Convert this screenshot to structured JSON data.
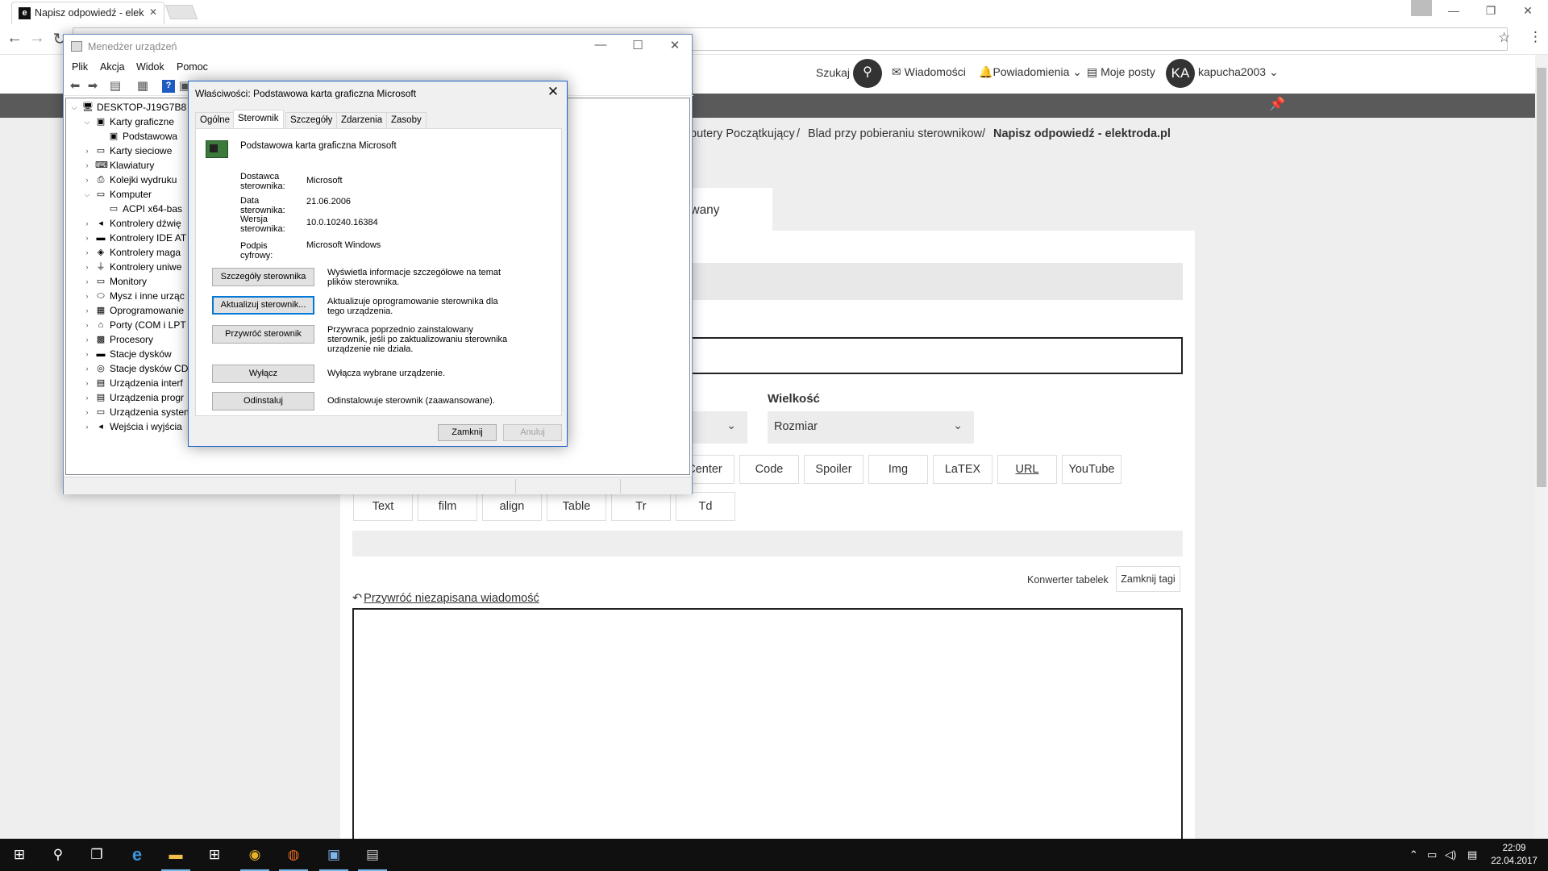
{
  "browser": {
    "tab_title": "Napisz odpowiedź - elek",
    "tab_favicon": "e",
    "close_glyph": "✕",
    "window_minimize": "—",
    "window_restore": "❐",
    "window_close": "✕",
    "back_glyph": "←",
    "forward_glyph": "→",
    "reload_glyph": "↻",
    "star_glyph": "☆",
    "menu_glyph": "⋮"
  },
  "site_header": {
    "search_label": "Szukaj",
    "search_glyph": "⚲",
    "messages": "Wiadomości",
    "notifications": "Powiadomienia",
    "my_posts": "Moje posty",
    "avatar_initials": "KA",
    "username": "kapucha2003",
    "pin_glyph": "📌"
  },
  "breadcrumb": {
    "item1": "putery Początkujący",
    "sep": "/",
    "item2": "Blad przy pobieraniu sterownikow",
    "item3": "Napisz odpowiedź - elektroda.pl"
  },
  "editor": {
    "tab_active_label": "sowany",
    "size_label": "Wielkość",
    "size_select": "Rozmiar",
    "chevron": "⌄",
    "bb_row1": [
      "Center",
      "Code",
      "Spoiler",
      "Img",
      "LaTEX",
      "URL",
      "YouTube"
    ],
    "bb_row2": [
      "Text",
      "film",
      "align",
      "Table",
      "Tr",
      "Td"
    ],
    "converter_label": "Konwerter tabelek",
    "close_tags": "Zamknij tagi",
    "restore_link": "Przywróć niezapisana wiadomość",
    "restore_glyph": "↶"
  },
  "device_manager": {
    "title": "Menedżer urządzeń",
    "menu": [
      "Plik",
      "Akcja",
      "Widok",
      "Pomoc"
    ],
    "tree": [
      {
        "label": "DESKTOP-J19G7B8",
        "level": 0,
        "toggle": "⌵",
        "icon": "computer-icon",
        "glyph": "🖥"
      },
      {
        "label": "Karty graficzne",
        "level": 1,
        "toggle": "⌵",
        "icon": "display-adapter-icon",
        "glyph": "▣"
      },
      {
        "label": "Podstawowa",
        "level": 2,
        "toggle": "",
        "icon": "display-adapter-icon",
        "glyph": "▣"
      },
      {
        "label": "Karty sieciowe",
        "level": 1,
        "toggle": "›",
        "icon": "network-adapter-icon",
        "glyph": "▭"
      },
      {
        "label": "Klawiatury",
        "level": 1,
        "toggle": "›",
        "icon": "keyboard-icon",
        "glyph": "⌨"
      },
      {
        "label": "Kolejki wydruku",
        "level": 1,
        "toggle": "›",
        "icon": "printer-icon",
        "glyph": "⎙"
      },
      {
        "label": "Komputer",
        "level": 1,
        "toggle": "⌵",
        "icon": "computer-icon",
        "glyph": "▭"
      },
      {
        "label": "ACPI x64-bas",
        "level": 2,
        "toggle": "",
        "icon": "computer-icon",
        "glyph": "▭"
      },
      {
        "label": "Kontrolery dźwię",
        "level": 1,
        "toggle": "›",
        "icon": "sound-icon",
        "glyph": "◂"
      },
      {
        "label": "Kontrolery IDE AT",
        "level": 1,
        "toggle": "›",
        "icon": "ide-icon",
        "glyph": "▬"
      },
      {
        "label": "Kontrolery maga",
        "level": 1,
        "toggle": "›",
        "icon": "storage-icon",
        "glyph": "◈"
      },
      {
        "label": "Kontrolery uniwe",
        "level": 1,
        "toggle": "›",
        "icon": "usb-icon",
        "glyph": "⏚"
      },
      {
        "label": "Monitory",
        "level": 1,
        "toggle": "›",
        "icon": "monitor-icon",
        "glyph": "▭"
      },
      {
        "label": "Mysz i inne urząc",
        "level": 1,
        "toggle": "›",
        "icon": "mouse-icon",
        "glyph": "⬭"
      },
      {
        "label": "Oprogramowanie",
        "level": 1,
        "toggle": "›",
        "icon": "firmware-icon",
        "glyph": "▦"
      },
      {
        "label": "Porty (COM i LPT",
        "level": 1,
        "toggle": "›",
        "icon": "port-icon",
        "glyph": "⌂"
      },
      {
        "label": "Procesory",
        "level": 1,
        "toggle": "›",
        "icon": "processor-icon",
        "glyph": "▩"
      },
      {
        "label": "Stacje dysków",
        "level": 1,
        "toggle": "›",
        "icon": "disk-drive-icon",
        "glyph": "▬"
      },
      {
        "label": "Stacje dysków CD",
        "level": 1,
        "toggle": "›",
        "icon": "cd-drive-icon",
        "glyph": "◎"
      },
      {
        "label": "Urządzenia interf",
        "level": 1,
        "toggle": "›",
        "icon": "hid-icon",
        "glyph": "▤"
      },
      {
        "label": "Urządzenia progr",
        "level": 1,
        "toggle": "›",
        "icon": "software-device-icon",
        "glyph": "▤"
      },
      {
        "label": "Urządzenia systen",
        "level": 1,
        "toggle": "›",
        "icon": "system-device-icon",
        "glyph": "▭"
      },
      {
        "label": "Wejścia i wyjścia",
        "level": 1,
        "toggle": "›",
        "icon": "audio-io-icon",
        "glyph": "◂"
      }
    ]
  },
  "properties": {
    "title": "Właściwości: Podstawowa karta graficzna Microsoft",
    "close_glyph": "✕",
    "tabs": [
      "Ogólne",
      "Sterownik",
      "Szczegóły",
      "Zdarzenia",
      "Zasoby"
    ],
    "active_tab": "Sterownik",
    "device_name": "Podstawowa karta graficzna Microsoft",
    "provider_label": "Dostawca sterownika:",
    "provider_value": "Microsoft",
    "date_label": "Data sterownika:",
    "date_value": "21.06.2006",
    "version_label": "Wersja sterownika:",
    "version_value": "10.0.10240.16384",
    "signer_label": "Podpis cyfrowy:",
    "signer_value": "Microsoft Windows",
    "btn_details": "Szczegóły sterownika",
    "desc_details": "Wyświetla informacje szczegółowe na temat plików sterownika.",
    "btn_update": "Aktualizuj sterownik...",
    "desc_update": "Aktualizuje oprogramowanie sterownika dla tego urządzenia.",
    "btn_rollback": "Przywróć sterownik",
    "desc_rollback": "Przywraca poprzednio zainstalowany sterownik, jeśli po zaktualizowaniu sterownika urządzenie nie działa.",
    "btn_disable": "Wyłącz",
    "desc_disable": "Wyłącza wybrane urządzenie.",
    "btn_uninstall": "Odinstaluj",
    "desc_uninstall": "Odinstalowuje sterownik (zaawansowane).",
    "btn_close": "Zamknij",
    "btn_cancel": "Anuluj"
  },
  "taskbar": {
    "start_glyph": "⊞",
    "search_glyph": "⚲",
    "taskview_glyph": "❐",
    "edge_glyph": "e",
    "explorer_glyph": "▬",
    "store_glyph": "⊞",
    "chrome_glyph": "◉",
    "firefox_glyph": "◍",
    "devmgr_glyph": "▣",
    "props_glyph": "▤",
    "tray_up": "⌃",
    "tray_network": "▭",
    "tray_volume": "◁)",
    "tray_notifications": "▤",
    "time": "22:09",
    "date": "22.04.2017"
  },
  "colors": {
    "accent_blue": "#0078d7",
    "dark_bar": "#5a5a5a",
    "taskbar": "#101010"
  }
}
